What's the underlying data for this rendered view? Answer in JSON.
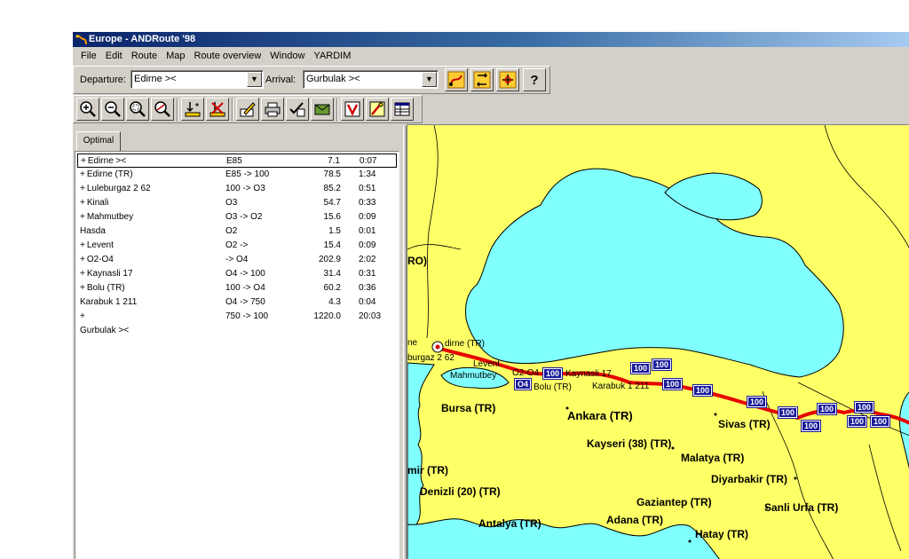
{
  "window": {
    "title": "Europe - ANDRoute '98"
  },
  "menu": [
    "File",
    "Edit",
    "Route",
    "Map",
    "Route overview",
    "Window",
    "YARDIM"
  ],
  "route_bar": {
    "departure_label": "Departure:",
    "departure_value": "Edirne ><",
    "arrival_label": "Arrival:",
    "arrival_value": "Gurbulak ><",
    "help_glyph": "?"
  },
  "panel": {
    "tab_label": "Optimal",
    "rows": [
      {
        "name": "Edirne ><",
        "road": "E85",
        "dist": "7.1",
        "time": "0:07",
        "plus": true,
        "selected": true
      },
      {
        "name": "Edirne (TR)",
        "road": "E85 -> 100",
        "dist": "78.5",
        "time": "1:34",
        "plus": true
      },
      {
        "name": "Luleburgaz 2 62",
        "road": "100 -> O3",
        "dist": "85.2",
        "time": "0:51",
        "plus": true
      },
      {
        "name": "Kinali",
        "road": "O3",
        "dist": "54.7",
        "time": "0:33",
        "plus": true
      },
      {
        "name": "Mahmutbey",
        "road": "O3 -> O2",
        "dist": "15.6",
        "time": "0:09",
        "plus": true
      },
      {
        "name": "Hasda",
        "road": "O2",
        "dist": "1.5",
        "time": "0:01",
        "plus": false
      },
      {
        "name": "Levent",
        "road": "O2 ->",
        "dist": "15.4",
        "time": "0:09",
        "plus": true
      },
      {
        "name": "O2-O4",
        "road": " -> O4",
        "dist": "202.9",
        "time": "2:02",
        "plus": true
      },
      {
        "name": "Kaynasli 17",
        "road": "O4 -> 100",
        "dist": "31.4",
        "time": "0:31",
        "plus": true
      },
      {
        "name": "Bolu (TR)",
        "road": "100 -> O4",
        "dist": "60.2",
        "time": "0:36",
        "plus": true
      },
      {
        "name": "Karabuk 1 211",
        "road": "O4 -> 750",
        "dist": "4.3",
        "time": "0:04",
        "plus": false
      },
      {
        "name": "",
        "road": "750 -> 100",
        "dist": "1220.0",
        "time": "20:03",
        "plus": true
      },
      {
        "name": "Gurbulak ><",
        "road": "",
        "dist": "",
        "time": "",
        "plus": false
      }
    ]
  },
  "map": {
    "cities": {
      "bursa": "Bursa (TR)",
      "ankara": "Ankara (TR)",
      "sivas": "Sivas (TR)",
      "kayseri": "Kayseri (38) (TR)",
      "malatya": "Malatya (TR)",
      "diyarbakir": "Diyarbakir (TR)",
      "gaziantep": "Gaziantep (TR)",
      "sanliurfa": "Sanli Urfa (TR)",
      "adana": "Adana (TR)",
      "hatay": "Hatay (TR)",
      "antalya": "Antalya (TR)",
      "denizli": "Denizli (20) (TR)",
      "izmir": "mir (TR)",
      "ro": "RO)",
      "edirne": "dirne (TR)",
      "luleburgaz": "burgaz 2 62",
      "levent": "Levent",
      "mahmutbey": "Mahmutbey",
      "o2o4": "O2-O4",
      "kaynasli": "Kaynasli 17",
      "bolu": "Bolu (TR)",
      "karabuk": "Karabuk 1 211",
      "ne": "ne"
    },
    "shields": {
      "s1": "100",
      "s2": "O4",
      "s3": "100",
      "s4": "100",
      "s5": "100",
      "s6": "100",
      "s7": "100",
      "s8": "100",
      "s9": "100",
      "s10": "100",
      "s11": "100",
      "s12": "100",
      "s13": "100"
    },
    "colors": {
      "sea": "#80ffff",
      "land": "#ffff66",
      "route": "#e60000",
      "shield": "#1a1a9a"
    }
  }
}
